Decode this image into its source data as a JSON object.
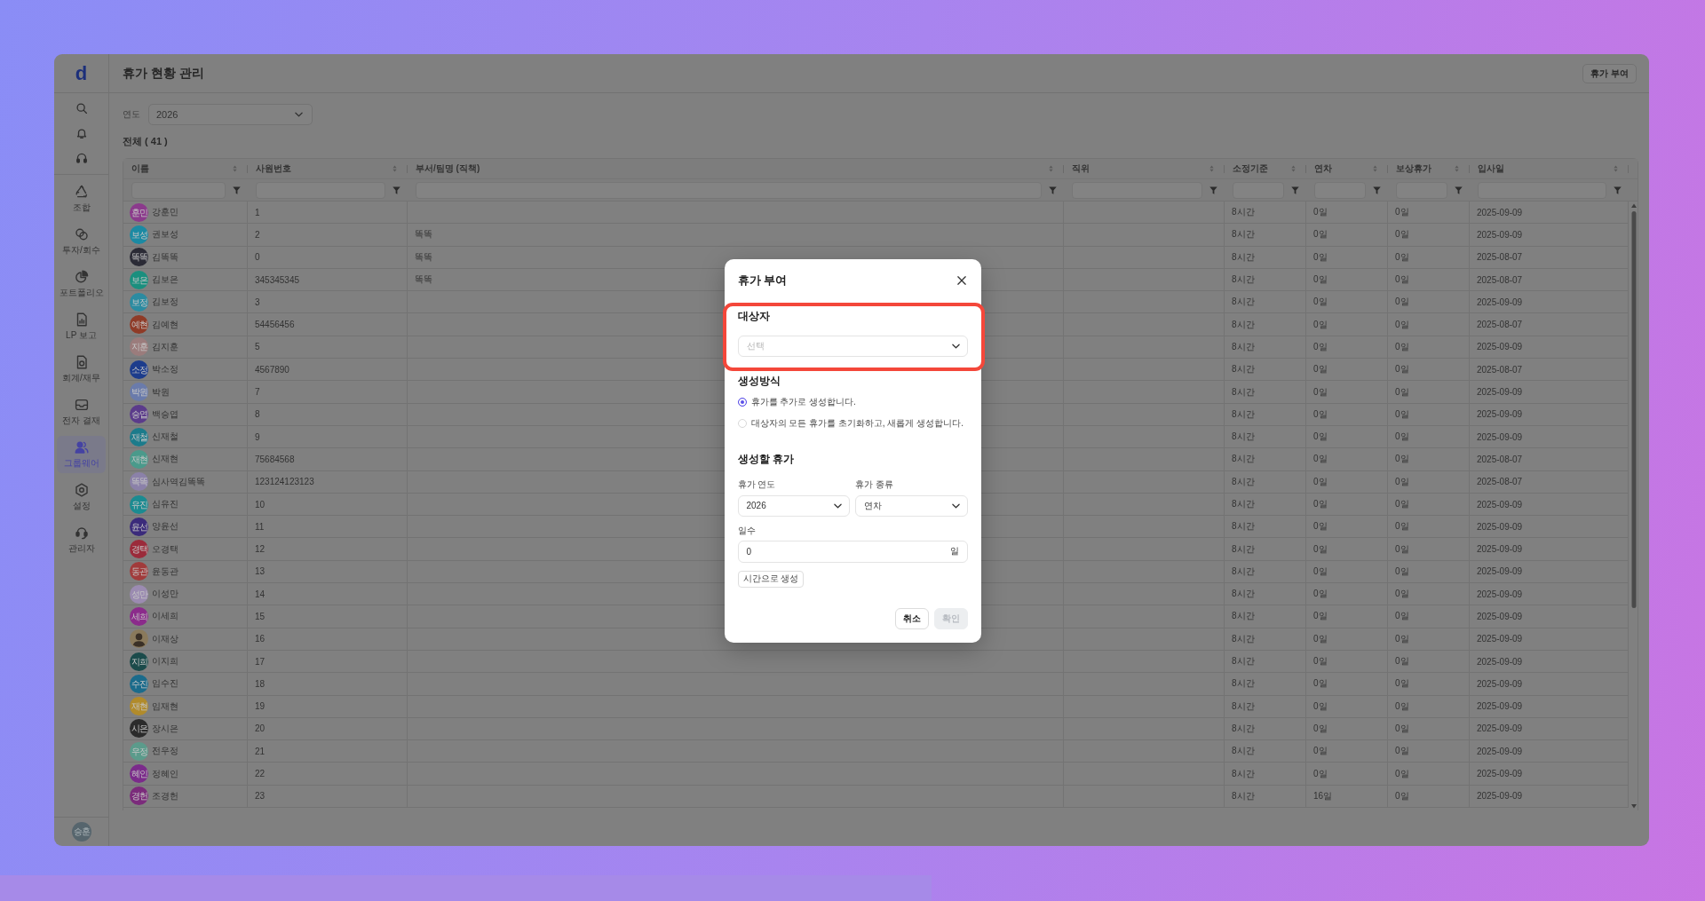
{
  "app": {
    "logo": "d",
    "sidebar": {
      "items": [
        {
          "label": "조합",
          "selected": false
        },
        {
          "label": "투자/회수",
          "selected": false
        },
        {
          "label": "포트폴리오",
          "selected": false
        },
        {
          "label": "LP 보고",
          "selected": false
        },
        {
          "label": "회계/재무",
          "selected": false
        },
        {
          "label": "전자 결재",
          "selected": false
        },
        {
          "label": "그룹웨어",
          "selected": true
        },
        {
          "label": "설정",
          "selected": false
        },
        {
          "label": "관리자",
          "selected": false
        }
      ]
    },
    "user_avatar": "승훈"
  },
  "header": {
    "title": "휴가 현황 관리",
    "button": "휴가 부여"
  },
  "filters": {
    "year_label": "연도",
    "year_value": "2026"
  },
  "total": "전체 ( 41 )",
  "table": {
    "columns": [
      {
        "label": "이름"
      },
      {
        "label": "사원번호"
      },
      {
        "label": "부서/팀명 (직책)"
      },
      {
        "label": "직위"
      },
      {
        "label": "소정기준"
      },
      {
        "label": "연차"
      },
      {
        "label": "보상휴가"
      },
      {
        "label": "입사일"
      }
    ],
    "rows": [
      {
        "avatar": {
          "kind": "initials",
          "text": "훈민",
          "color": "#8b3a8c"
        },
        "name": "강훈민",
        "employee_no": "1",
        "base_hours": "8시간",
        "annual_leave": "0일",
        "comp_leave": "0일",
        "hire_date": "2025-09-09"
      },
      {
        "avatar": {
          "kind": "initials",
          "text": "보성",
          "color": "#1b8aa3"
        },
        "name": "권보성",
        "employee_no": "2",
        "department": "똑똑",
        "base_hours": "8시간",
        "annual_leave": "0일",
        "comp_leave": "0일",
        "hire_date": "2025-09-09"
      },
      {
        "avatar": {
          "kind": "initials",
          "text": "똑똑",
          "color": "#2b2b36"
        },
        "name": "김똑똑",
        "employee_no": "0",
        "department": "똑똑",
        "base_hours": "8시간",
        "annual_leave": "0일",
        "comp_leave": "0일",
        "hire_date": "2025-08-07"
      },
      {
        "avatar": {
          "kind": "initials",
          "text": "보은",
          "color": "#1a8f7e"
        },
        "name": "김보은",
        "employee_no": "345345345",
        "department": "똑똑",
        "base_hours": "8시간",
        "annual_leave": "0일",
        "comp_leave": "0일",
        "hire_date": "2025-08-07"
      },
      {
        "avatar": {
          "kind": "initials",
          "text": "보정",
          "color": "#2b8ba1"
        },
        "name": "김보정",
        "employee_no": "3",
        "base_hours": "8시간",
        "annual_leave": "0일",
        "comp_leave": "0일",
        "hire_date": "2025-09-09"
      },
      {
        "avatar": {
          "kind": "initials",
          "text": "예현",
          "color": "#8f3b27"
        },
        "name": "김예현",
        "employee_no": "54456456",
        "base_hours": "8시간",
        "annual_leave": "0일",
        "comp_leave": "0일",
        "hire_date": "2025-08-07"
      },
      {
        "avatar": {
          "kind": "initials",
          "text": "지훈",
          "color": "#9b7c7c"
        },
        "name": "김지훈",
        "employee_no": "5",
        "base_hours": "8시간",
        "annual_leave": "0일",
        "comp_leave": "0일",
        "hire_date": "2025-09-09"
      },
      {
        "avatar": {
          "kind": "initials",
          "text": "소정",
          "color": "#1c3c8c"
        },
        "name": "박소정",
        "employee_no": "4567890",
        "base_hours": "8시간",
        "annual_leave": "0일",
        "comp_leave": "0일",
        "hire_date": "2025-08-07"
      },
      {
        "avatar": {
          "kind": "initials",
          "text": "박원",
          "color": "#6a7bab"
        },
        "name": "박원",
        "employee_no": "7",
        "base_hours": "8시간",
        "annual_leave": "0일",
        "comp_leave": "0일",
        "hire_date": "2025-09-09"
      },
      {
        "avatar": {
          "kind": "initials",
          "text": "승엽",
          "color": "#5b3b8b"
        },
        "name": "백승엽",
        "employee_no": "8",
        "base_hours": "8시간",
        "annual_leave": "0일",
        "comp_leave": "0일",
        "hire_date": "2025-09-09"
      },
      {
        "avatar": {
          "kind": "initials",
          "text": "재철",
          "color": "#1c7b8b"
        },
        "name": "신재철",
        "employee_no": "9",
        "base_hours": "8시간",
        "annual_leave": "0일",
        "comp_leave": "0일",
        "hire_date": "2025-09-09"
      },
      {
        "avatar": {
          "kind": "initials",
          "text": "재현",
          "color": "#4a9a8b"
        },
        "name": "신재현",
        "employee_no": "75684568",
        "base_hours": "8시간",
        "annual_leave": "0일",
        "comp_leave": "0일",
        "hire_date": "2025-08-07"
      },
      {
        "avatar": {
          "kind": "initials",
          "text": "똑똑",
          "color": "#8b81a9"
        },
        "name": "심사역김똑똑",
        "employee_no": "123124123123",
        "base_hours": "8시간",
        "annual_leave": "0일",
        "comp_leave": "0일",
        "hire_date": "2025-08-07"
      },
      {
        "avatar": {
          "kind": "initials",
          "text": "유진",
          "color": "#1b8b91"
        },
        "name": "심유진",
        "employee_no": "10",
        "base_hours": "8시간",
        "annual_leave": "0일",
        "comp_leave": "0일",
        "hire_date": "2025-09-09"
      },
      {
        "avatar": {
          "kind": "initials",
          "text": "윤선",
          "color": "#3b2b7b"
        },
        "name": "양윤선",
        "employee_no": "11",
        "base_hours": "8시간",
        "annual_leave": "0일",
        "comp_leave": "0일",
        "hire_date": "2025-09-09"
      },
      {
        "avatar": {
          "kind": "initials",
          "text": "경택",
          "color": "#9b2b3b"
        },
        "name": "오경택",
        "employee_no": "12",
        "base_hours": "8시간",
        "annual_leave": "0일",
        "comp_leave": "0일",
        "hire_date": "2025-09-09"
      },
      {
        "avatar": {
          "kind": "initials",
          "text": "동관",
          "color": "#a13b3b"
        },
        "name": "윤동관",
        "employee_no": "13",
        "base_hours": "8시간",
        "annual_leave": "0일",
        "comp_leave": "0일",
        "hire_date": "2025-09-09"
      },
      {
        "avatar": {
          "kind": "initials",
          "text": "성만",
          "color": "#9b8bb1"
        },
        "name": "이성만",
        "employee_no": "14",
        "base_hours": "8시간",
        "annual_leave": "0일",
        "comp_leave": "0일",
        "hire_date": "2025-09-09"
      },
      {
        "avatar": {
          "kind": "initials",
          "text": "세희",
          "color": "#8b2b8b"
        },
        "name": "이세희",
        "employee_no": "15",
        "base_hours": "8시간",
        "annual_leave": "0일",
        "comp_leave": "0일",
        "hire_date": "2025-09-09"
      },
      {
        "avatar": {
          "kind": "image"
        },
        "name": "이재상",
        "employee_no": "16",
        "base_hours": "8시간",
        "annual_leave": "0일",
        "comp_leave": "0일",
        "hire_date": "2025-09-09"
      },
      {
        "avatar": {
          "kind": "initials",
          "text": "지희",
          "color": "#1b4b4b"
        },
        "name": "이지희",
        "employee_no": "17",
        "base_hours": "8시간",
        "annual_leave": "0일",
        "comp_leave": "0일",
        "hire_date": "2025-09-09"
      },
      {
        "avatar": {
          "kind": "initials",
          "text": "수진",
          "color": "#1b6b8b"
        },
        "name": "임수진",
        "employee_no": "18",
        "base_hours": "8시간",
        "annual_leave": "0일",
        "comp_leave": "0일",
        "hire_date": "2025-09-09"
      },
      {
        "avatar": {
          "kind": "initials",
          "text": "재현",
          "color": "#b18b2b"
        },
        "name": "임재현",
        "employee_no": "19",
        "base_hours": "8시간",
        "annual_leave": "0일",
        "comp_leave": "0일",
        "hire_date": "2025-09-09"
      },
      {
        "avatar": {
          "kind": "initials",
          "text": "시은",
          "color": "#2b2b2b"
        },
        "name": "장시은",
        "employee_no": "20",
        "base_hours": "8시간",
        "annual_leave": "0일",
        "comp_leave": "0일",
        "hire_date": "2025-09-09"
      },
      {
        "avatar": {
          "kind": "initials",
          "text": "우정",
          "color": "#5b9b8b"
        },
        "name": "전우정",
        "employee_no": "21",
        "base_hours": "8시간",
        "annual_leave": "0일",
        "comp_leave": "0일",
        "hire_date": "2025-09-09"
      },
      {
        "avatar": {
          "kind": "initials",
          "text": "혜인",
          "color": "#7b2b8b"
        },
        "name": "정혜인",
        "employee_no": "22",
        "base_hours": "8시간",
        "annual_leave": "0일",
        "comp_leave": "0일",
        "hire_date": "2025-09-09"
      },
      {
        "avatar": {
          "kind": "initials",
          "text": "경헌",
          "color": "#7b2b7b"
        },
        "name": "조경헌",
        "employee_no": "23",
        "base_hours": "8시간",
        "annual_leave": "16일",
        "comp_leave": "0일",
        "hire_date": "2025-09-09"
      }
    ]
  },
  "dialog": {
    "title": "휴가 부여",
    "recipient": {
      "label": "대상자",
      "placeholder": "선택",
      "highlighted": true
    },
    "method": {
      "label": "생성방식",
      "options": [
        {
          "label": "휴가를 추가로 생성합니다.",
          "selected": true
        },
        {
          "label": "대상자의 모든 휴가를 초기화하고, 새롭게 생성합니다.",
          "selected": false
        }
      ]
    },
    "leave": {
      "heading": "생성할 휴가",
      "year": {
        "label": "휴가 연도",
        "value": "2026"
      },
      "type": {
        "label": "휴가 종류",
        "value": "연차"
      },
      "days": {
        "label": "일수",
        "value": "0",
        "unit": "일"
      },
      "hours_button": "시간으로 생성"
    },
    "buttons": [
      {
        "label": "취소",
        "disabled": false
      },
      {
        "label": "확인",
        "disabled": true
      }
    ]
  }
}
